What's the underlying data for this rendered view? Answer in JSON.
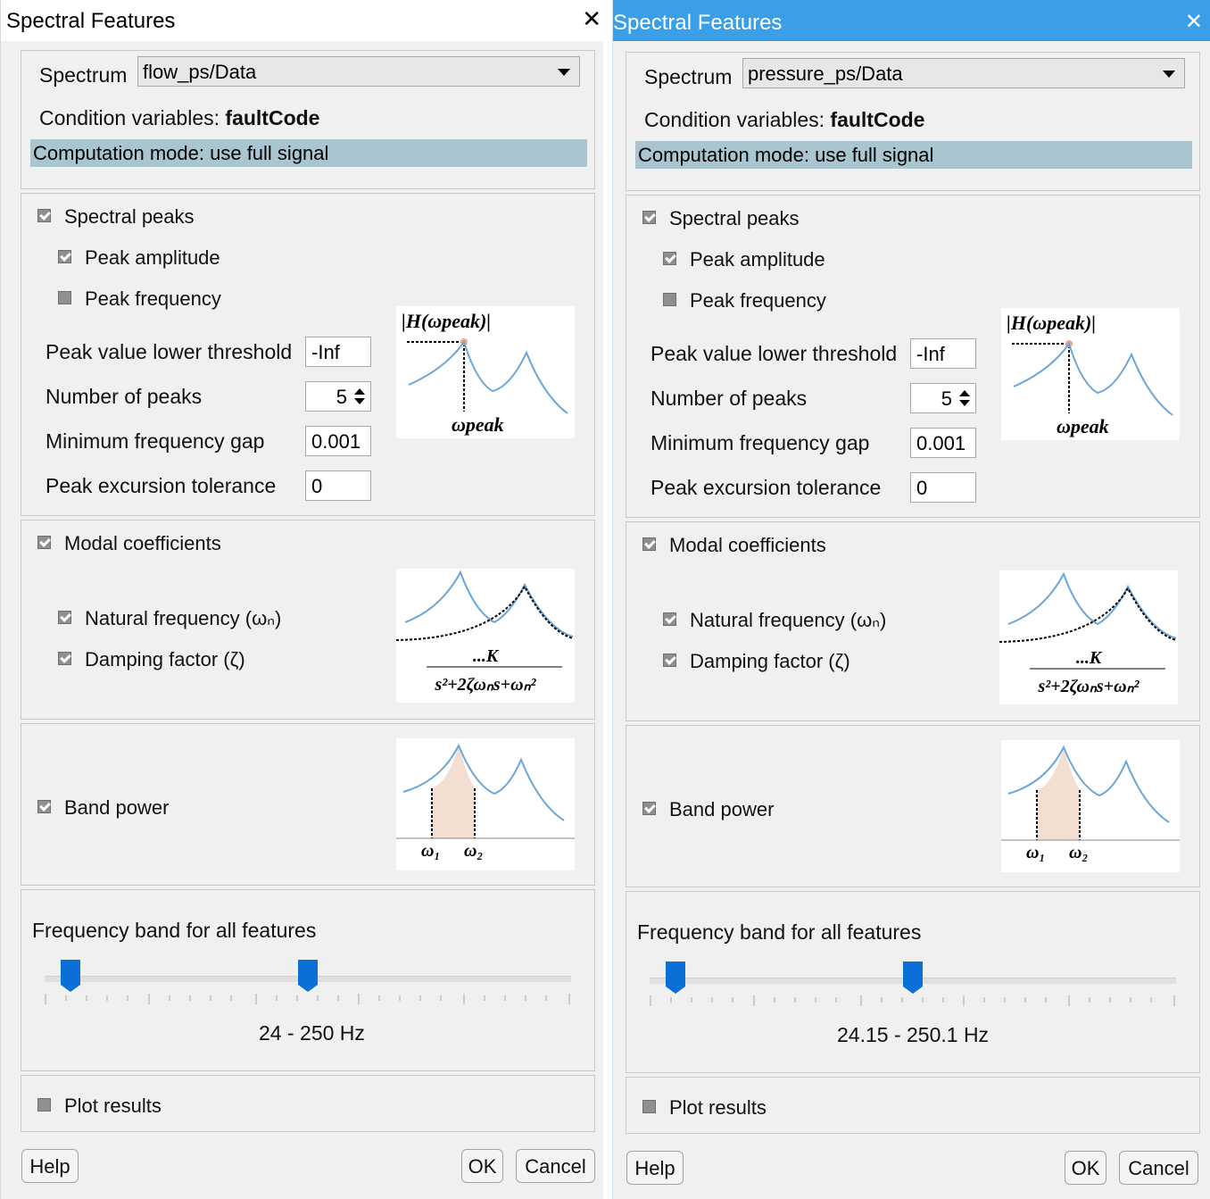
{
  "dialogs": [
    {
      "title": "Spectral Features",
      "spectrum_label": "Spectrum",
      "spectrum_value": "flow_ps/Data",
      "condition_label": "Condition variables:",
      "condition_value": "faultCode",
      "computation_mode": "Computation mode: use full signal",
      "spectral_peaks": {
        "label": "Spectral peaks",
        "checked": true
      },
      "peak_amplitude": {
        "label": "Peak amplitude",
        "checked": true
      },
      "peak_frequency": {
        "label": "Peak frequency",
        "checked": false
      },
      "threshold_label": "Peak value lower threshold",
      "threshold_value": "-Inf",
      "num_peaks_label": "Number of peaks",
      "num_peaks_value": "5",
      "min_gap_label": "Minimum frequency gap",
      "min_gap_value": "0.001",
      "excursion_label": "Peak excursion tolerance",
      "excursion_value": "0",
      "modal_coefficients": {
        "label": "Modal coefficients",
        "checked": true
      },
      "natural_frequency": {
        "label": "Natural frequency (ωₙ)",
        "checked": true
      },
      "damping_factor": {
        "label": "Damping factor (ζ)",
        "checked": true
      },
      "band_power": {
        "label": "Band power",
        "checked": true
      },
      "freq_band_label": "Frequency band for all features",
      "freq_band_range": "24 -  250 Hz",
      "plot_results": {
        "label": "Plot results",
        "checked": false
      },
      "help_label": "Help",
      "ok_label": "OK",
      "cancel_label": "Cancel"
    },
    {
      "title": "Spectral Features",
      "spectrum_label": "Spectrum",
      "spectrum_value": "pressure_ps/Data",
      "condition_label": "Condition variables:",
      "condition_value": "faultCode",
      "computation_mode": "Computation mode: use full signal",
      "spectral_peaks": {
        "label": "Spectral peaks",
        "checked": true
      },
      "peak_amplitude": {
        "label": "Peak amplitude",
        "checked": true
      },
      "peak_frequency": {
        "label": "Peak frequency",
        "checked": false
      },
      "threshold_label": "Peak value lower threshold",
      "threshold_value": "-Inf",
      "num_peaks_label": "Number of peaks",
      "num_peaks_value": "5",
      "min_gap_label": "Minimum frequency gap",
      "min_gap_value": "0.001",
      "excursion_label": "Peak excursion tolerance",
      "excursion_value": "0",
      "modal_coefficients": {
        "label": "Modal coefficients",
        "checked": true
      },
      "natural_frequency": {
        "label": "Natural frequency (ωₙ)",
        "checked": true
      },
      "damping_factor": {
        "label": "Damping factor (ζ)",
        "checked": true
      },
      "band_power": {
        "label": "Band power",
        "checked": true
      },
      "freq_band_label": "Frequency band for all features",
      "freq_band_range": "24.15 - 250.1 Hz",
      "plot_results": {
        "label": "Plot results",
        "checked": false
      },
      "help_label": "Help",
      "ok_label": "OK",
      "cancel_label": "Cancel"
    }
  ],
  "illustrations": {
    "peak_amplitude_axis": "|H(ωpeak)|",
    "peak_omega": "ωpeak",
    "modal_numerator": "...K",
    "modal_denominator": "s²+2ζωₙs+ωₙ²",
    "band_w1": "ω₁",
    "band_w2": "ω₂"
  },
  "colors": {
    "titlebar_active": "#3a9fe6",
    "mode_bar": "#a9c5cf",
    "curve": "#6aa6d8",
    "slider_thumb": "#0a6fd6",
    "band_fill": "#f3ded2"
  }
}
